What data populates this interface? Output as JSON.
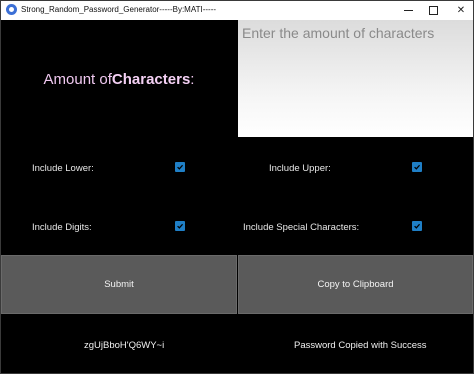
{
  "window": {
    "title": "Strong_Random_Password_Generator-----By:MATI-----",
    "icon": "app-icon"
  },
  "amount": {
    "label_prefix": "Amount of ",
    "label_bold": "Characters",
    "label_suffix": ":",
    "input_placeholder": "Enter the amount of characters"
  },
  "options": {
    "include_lower": {
      "label": "Include Lower:",
      "checked": true
    },
    "include_upper": {
      "label": "Include Upper:",
      "checked": true
    },
    "include_digits": {
      "label": "Include Digits:",
      "checked": true
    },
    "include_special": {
      "label": "Include Special Characters:",
      "checked": true
    }
  },
  "buttons": {
    "submit": "Submit",
    "copy": "Copy to Clipboard"
  },
  "output": {
    "password": "zgUjBboH'Q6WY~i",
    "status": "Password Copied with Success"
  },
  "colors": {
    "background": "#000000",
    "label_pink": "#f0c8f0",
    "checkbox": "#1f7fc6",
    "button": "#5a5a5a"
  }
}
